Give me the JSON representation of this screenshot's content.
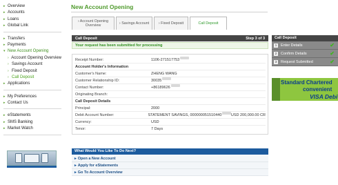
{
  "sidebar": {
    "groups": [
      [
        {
          "label": "Overview",
          "bullet": true
        },
        {
          "label": "Accounts",
          "bullet": true
        },
        {
          "label": "Loans",
          "bullet": true
        },
        {
          "label": "Global Link",
          "bullet": true
        }
      ],
      [
        {
          "label": "Transfers",
          "bullet": true
        },
        {
          "label": "Payments",
          "bullet": true
        },
        {
          "label": "New Account Opening",
          "bullet": true,
          "active": true
        },
        {
          "label": "Account Opening Overview",
          "sub": true
        },
        {
          "label": "Savings Account",
          "sub": true
        },
        {
          "label": "Fixed Deposit",
          "sub": true
        },
        {
          "label": "Call Deposit",
          "sub": true,
          "active": true
        },
        {
          "label": "Applications",
          "bullet": true
        }
      ],
      [
        {
          "label": "My Preferences",
          "bullet": true
        },
        {
          "label": "Contact Us",
          "bullet": true
        }
      ],
      [
        {
          "label": "eStatements",
          "bullet": true
        },
        {
          "label": "SMS Banking",
          "bullet": true
        },
        {
          "label": "Market Watch",
          "bullet": true
        }
      ]
    ]
  },
  "main": {
    "title": "New Account Opening",
    "tabs": [
      {
        "label": "› Account Opening Overview"
      },
      {
        "label": "› Savings Account"
      },
      {
        "label": "› Fixed Deposit"
      },
      {
        "label": "Call Deposit",
        "active": true
      }
    ],
    "panel_title": "Call Deposit",
    "step_text": "Step 3 of 3",
    "success_message": "Your request has been submitted for processing",
    "rows": [
      {
        "label": "Receipt Number:",
        "value": "1106-271517753",
        "masked": true
      },
      {
        "label": "Account Holder's Information",
        "section": true
      },
      {
        "label": "Customer's Name:",
        "value": "ZHENG WANG"
      },
      {
        "label": "Customer Relationship ID:",
        "value": "30035",
        "masked": true
      },
      {
        "label": "Contact Number:",
        "value": "+86189626",
        "masked": true
      },
      {
        "label": "Originating Branch:",
        "value": ""
      },
      {
        "label": "Call Deposit Details",
        "section": true
      },
      {
        "label": "Principal:",
        "value": "2000"
      },
      {
        "label": "Debit Account Number:",
        "value": "STATEMENT SAVINGS, 000000051510440",
        "masked": true,
        "value_suffix": " USD 200,000.00 CR"
      },
      {
        "label": "Currency:",
        "value": "USD"
      },
      {
        "label": "Tenor:",
        "value": "7 Days"
      }
    ],
    "next_title": "What Would You Like To Do Next?",
    "next_links": [
      {
        "label": "Open a New Account"
      },
      {
        "label": "Apply for eStatements"
      },
      {
        "label": "Go To Account Overview"
      }
    ]
  },
  "steps_panel": {
    "title": "Call Deposit",
    "steps": [
      {
        "num": "1",
        "label": "Enter Details"
      },
      {
        "num": "2",
        "label": "Confirm Details"
      },
      {
        "num": "3",
        "label": "Request Submitted"
      }
    ]
  },
  "ad": {
    "line1": "Standard Chartered",
    "line2": "convenient",
    "line3": "VISA Debi"
  }
}
